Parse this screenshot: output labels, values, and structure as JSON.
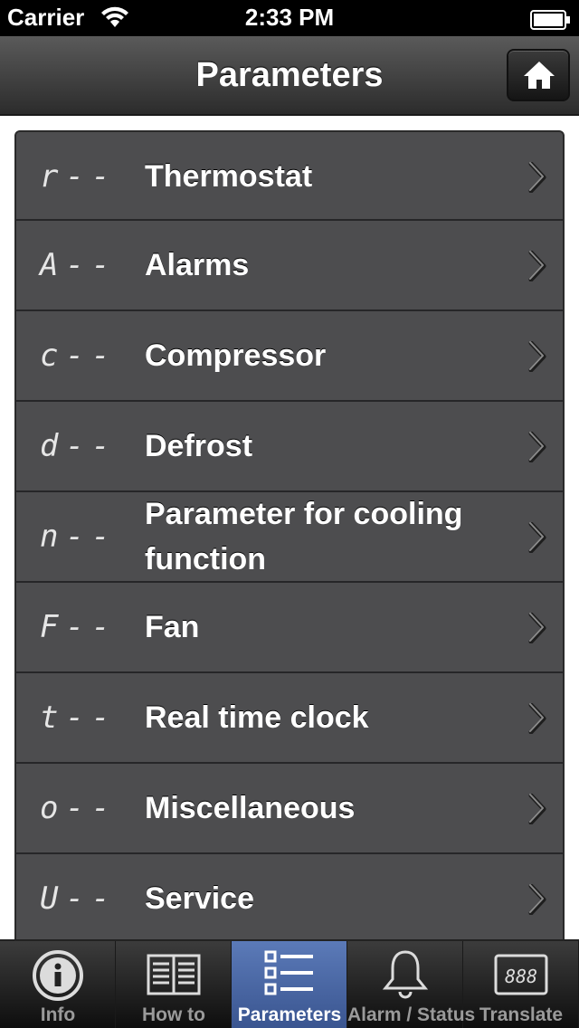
{
  "status_bar": {
    "carrier": "Carrier",
    "time": "2:33 PM"
  },
  "nav": {
    "title": "Parameters",
    "home_icon": "home-icon"
  },
  "parameters": [
    {
      "code": "r--",
      "label": "Thermostat"
    },
    {
      "code": "A--",
      "label": "Alarms"
    },
    {
      "code": "c--",
      "label": "Compressor"
    },
    {
      "code": "d--",
      "label": "Defrost"
    },
    {
      "code": "n--",
      "label": "Parameter for cooling function"
    },
    {
      "code": "F--",
      "label": "Fan"
    },
    {
      "code": "t--",
      "label": "Real time clock"
    },
    {
      "code": "o--",
      "label": "Miscellaneous"
    },
    {
      "code": "U--",
      "label": "Service"
    }
  ],
  "tabs": [
    {
      "label": "Info",
      "icon": "info-icon",
      "active": false
    },
    {
      "label": "How to",
      "icon": "book-icon",
      "active": false
    },
    {
      "label": "Parameters",
      "icon": "list-icon",
      "active": true
    },
    {
      "label": "Alarm / Status",
      "icon": "bell-icon",
      "active": false
    },
    {
      "label": "Translate",
      "icon": "display-icon",
      "active": false
    }
  ],
  "colors": {
    "active_tab": "#4a67a4",
    "list_background": "#4d4d4f",
    "nav_background": "#3a3a3a"
  }
}
